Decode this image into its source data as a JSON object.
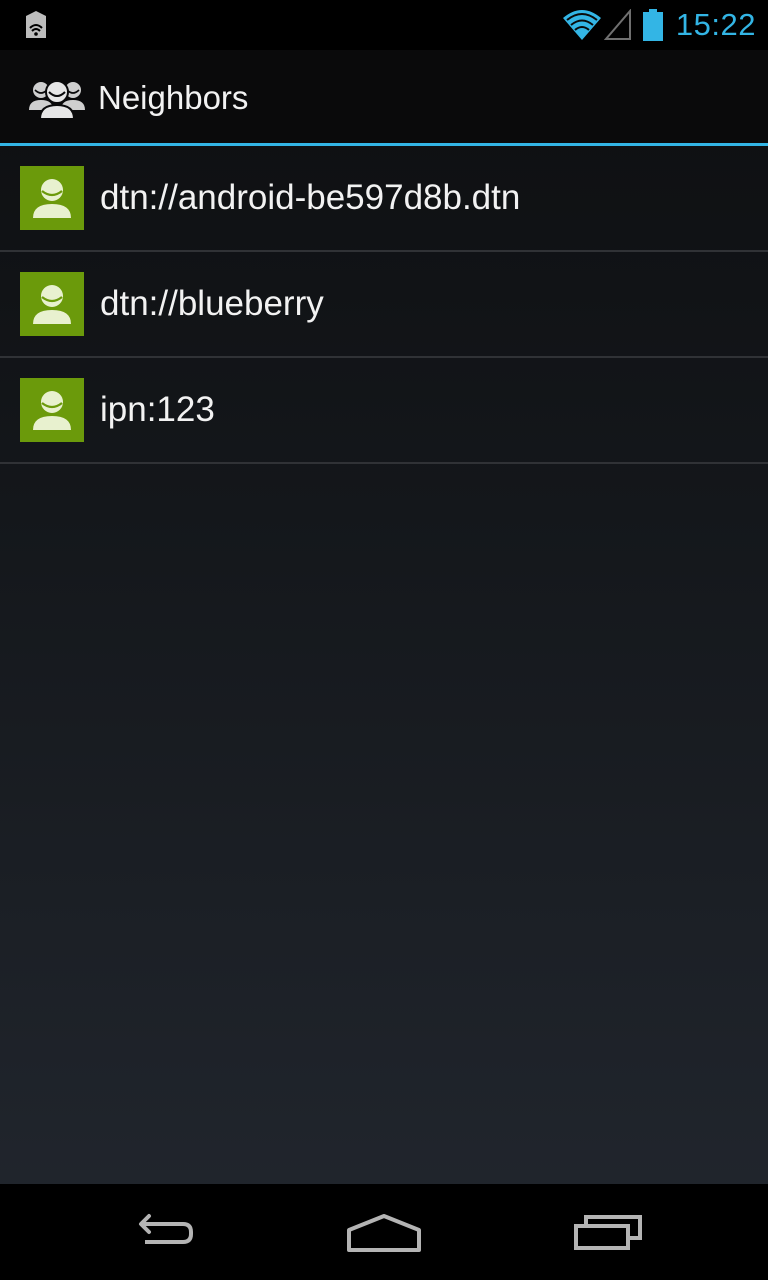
{
  "status_bar": {
    "time": "15:22",
    "left_icon": "notification-lamp-icon",
    "icons": [
      "wifi-icon",
      "signal-icon",
      "battery-icon"
    ],
    "accent_color": "#33b5e5"
  },
  "action_bar": {
    "icon": "neighbors-group-icon",
    "title": "Neighbors"
  },
  "neighbors": [
    {
      "label": "dtn://android-be597d8b.dtn",
      "icon": "person-avatar-icon"
    },
    {
      "label": "dtn://blueberry",
      "icon": "person-avatar-icon"
    },
    {
      "label": "ipn:123",
      "icon": "person-avatar-icon"
    }
  ],
  "nav_bar": {
    "buttons": [
      "back-icon",
      "home-icon",
      "recent-apps-icon"
    ]
  },
  "colors": {
    "avatar_green": "#6b9a0b",
    "accent": "#33b5e5"
  }
}
